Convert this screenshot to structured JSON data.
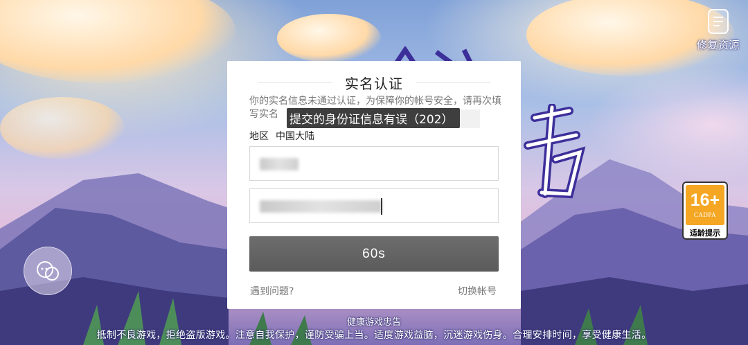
{
  "repair": {
    "label": "修复资源",
    "icon": "document-repair-icon"
  },
  "age_rating": {
    "age": "16+",
    "org": "CADPA",
    "tip": "适龄提示"
  },
  "dialog": {
    "title": "实名认证",
    "notice": "你的实名信息未通过认证，为保障你的帐号安全，请再次填写实名",
    "region_label": "地区",
    "region_value": "中国大陆",
    "submit_label": "60s",
    "help_link": "遇到问题?",
    "switch_link": "切换帐号"
  },
  "toast": {
    "text": "提交的身份证信息有误（202）"
  },
  "health_notice": {
    "title": "健康游戏忠告",
    "text": "抵制不良游戏，拒绝盗版游戏。注意自我保护，谨防受骗上当。适度游戏益脑，沉迷游戏伤身。合理安排时间，享受健康生活。"
  },
  "colors": {
    "age_badge": "#f5a623",
    "submit_button": "#5f5f5f",
    "toast_bg": "#1a1a1a"
  }
}
